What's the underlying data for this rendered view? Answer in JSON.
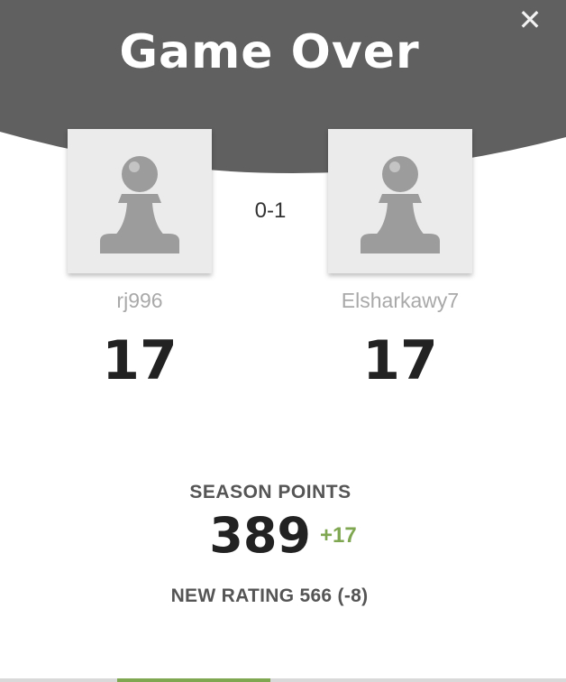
{
  "header": {
    "title": "Game Over",
    "close_symbol": "✕",
    "background_color": "#606060"
  },
  "players": [
    {
      "username": "rj996",
      "rating": "17",
      "avatar_icon": "pawn-icon"
    },
    {
      "username": "Elsharkawy7",
      "rating": "17",
      "avatar_icon": "pawn-icon"
    }
  ],
  "result": "0-1",
  "season": {
    "label": "SEASON POINTS",
    "value": "389",
    "delta": "+17",
    "delta_color": "#7fa650"
  },
  "new_rating": "NEW RATING 566 (-8)"
}
